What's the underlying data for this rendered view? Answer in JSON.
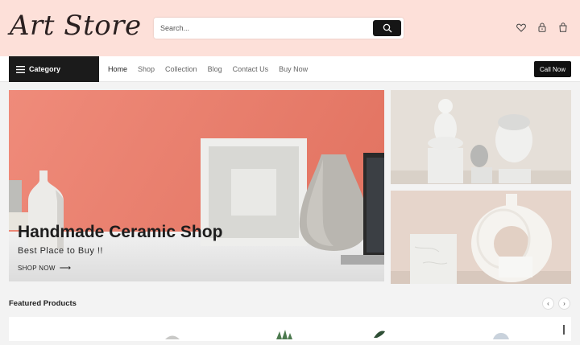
{
  "brand": {
    "name": "Art Store"
  },
  "search": {
    "placeholder": "Search..."
  },
  "header_icons": [
    "heart-icon",
    "lock-icon",
    "bag-icon"
  ],
  "nav": {
    "category_label": "Category",
    "links": [
      "Home",
      "Shop",
      "Collection",
      "Blog",
      "Contact Us",
      "Buy Now"
    ],
    "active": "Home",
    "call_now": "Call Now"
  },
  "hero": {
    "title": "Handmade Ceramic Shop",
    "subtitle": "Best Place to Buy !!",
    "cta": "SHOP NOW",
    "cta_arrow": "⟶"
  },
  "featured": {
    "title": "Featured Products",
    "prev": "‹",
    "next": "›"
  },
  "colors": {
    "topbar": "#fde0d9",
    "dark": "#1b1b1b",
    "hero_wall": "#e88473"
  }
}
